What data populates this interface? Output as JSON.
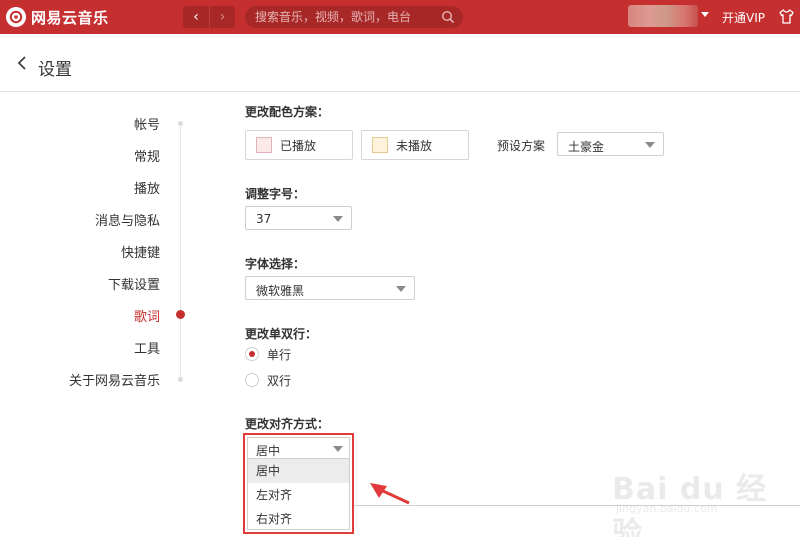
{
  "app": {
    "name": "网易云音乐",
    "vip_label": "开通VIP"
  },
  "topbar": {
    "back_glyph": "‹",
    "forward_glyph": "›",
    "search_placeholder": "搜索音乐，视频，歌词，电台"
  },
  "header": {
    "title": "设置"
  },
  "sidebar": {
    "items": [
      {
        "label": "帐号",
        "active": false
      },
      {
        "label": "常规",
        "active": false
      },
      {
        "label": "播放",
        "active": false
      },
      {
        "label": "消息与隐私",
        "active": false
      },
      {
        "label": "快捷键",
        "active": false
      },
      {
        "label": "下载设置",
        "active": false
      },
      {
        "label": "歌词",
        "active": true
      },
      {
        "label": "工具",
        "active": false
      },
      {
        "label": "关于网易云音乐",
        "active": false
      }
    ]
  },
  "lyrics_settings": {
    "color_scheme": {
      "title": "更改配色方案：",
      "played_label": "已播放",
      "played_color": "#fde8ea",
      "unplayed_label": "未播放",
      "unplayed_color": "#fdf3dc",
      "preset_label": "预设方案",
      "preset_value": "土豪金"
    },
    "font_size": {
      "title": "调整字号：",
      "value": "37"
    },
    "font_family": {
      "title": "字体选择：",
      "value": "微软雅黑"
    },
    "line_mode": {
      "title": "更改单双行：",
      "options": [
        {
          "label": "单行",
          "selected": true
        },
        {
          "label": "双行",
          "selected": false
        }
      ]
    },
    "alignment": {
      "title": "更改对齐方式：",
      "value": "居中",
      "options": [
        "居中",
        "左对齐",
        "右对齐"
      ],
      "highlighted": "居中"
    }
  },
  "watermark": {
    "brand": "Bai du 经验",
    "url": "jingyan.baidu.com"
  },
  "colors": {
    "brand_red": "#c62f2f",
    "annotation_red": "#e03a3a"
  }
}
